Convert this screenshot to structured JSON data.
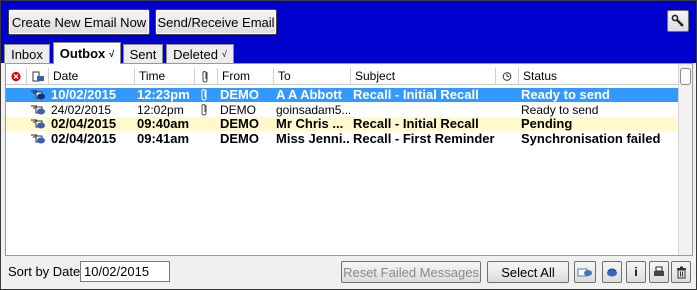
{
  "toolbar": {
    "create_label": "Create New Email Now",
    "sendrecv_label": "Send/Receive Email",
    "tool_icon": "tools-icon"
  },
  "tabs": [
    {
      "label": "Inbox",
      "tick": ""
    },
    {
      "label": "Outbox",
      "tick": "√"
    },
    {
      "label": "Sent",
      "tick": ""
    },
    {
      "label": "Deleted",
      "tick": "√"
    }
  ],
  "columns": {
    "error_icon": "error-icon",
    "type_icon": "email-type-icon",
    "date": "Date",
    "time": "Time",
    "attach_icon": "paperclip-icon",
    "from": "From",
    "to": "To",
    "subject": "Subject",
    "clock_icon": "clock-icon",
    "status": "Status"
  },
  "rows": [
    {
      "date": "10/02/2015",
      "time": "12:23pm",
      "attachment": true,
      "from": "DEMO",
      "to": "A A Abbott",
      "subject": "Recall - Initial Recall",
      "status": "Ready to send",
      "state": "selected",
      "bold": true
    },
    {
      "date": "24/02/2015",
      "time": "12:02pm",
      "attachment": true,
      "from": "DEMO",
      "to": "goinsadam5...",
      "subject": "",
      "status": "Ready to send",
      "state": "normal",
      "bold": false
    },
    {
      "date": "02/04/2015",
      "time": "09:40am",
      "attachment": false,
      "from": "DEMO",
      "to": "Mr Chris ...",
      "subject": "Recall - Initial Recall",
      "status": "Pending",
      "state": "pending",
      "bold": true
    },
    {
      "date": "02/04/2015",
      "time": "09:41am",
      "attachment": false,
      "from": "DEMO",
      "to": "Miss Jenni...",
      "subject": "Recall - First Reminder",
      "status": "Synchronisation failed",
      "state": "normal",
      "bold": true
    }
  ],
  "bottom": {
    "sort_label": "Sort by Date",
    "sort_value": "10/02/2015",
    "reset_label": "Reset Failed Messages",
    "selectall_label": "Select All",
    "icon_buttons": [
      "email-reply-icon",
      "info-icon",
      "printer-icon",
      "trash-icon"
    ],
    "info_glyph": "i"
  },
  "colors": {
    "topbar": "#0000cc",
    "selected_row": "#3399ff",
    "pending_row": "#fff9cc",
    "error_red": "#dd0000"
  }
}
